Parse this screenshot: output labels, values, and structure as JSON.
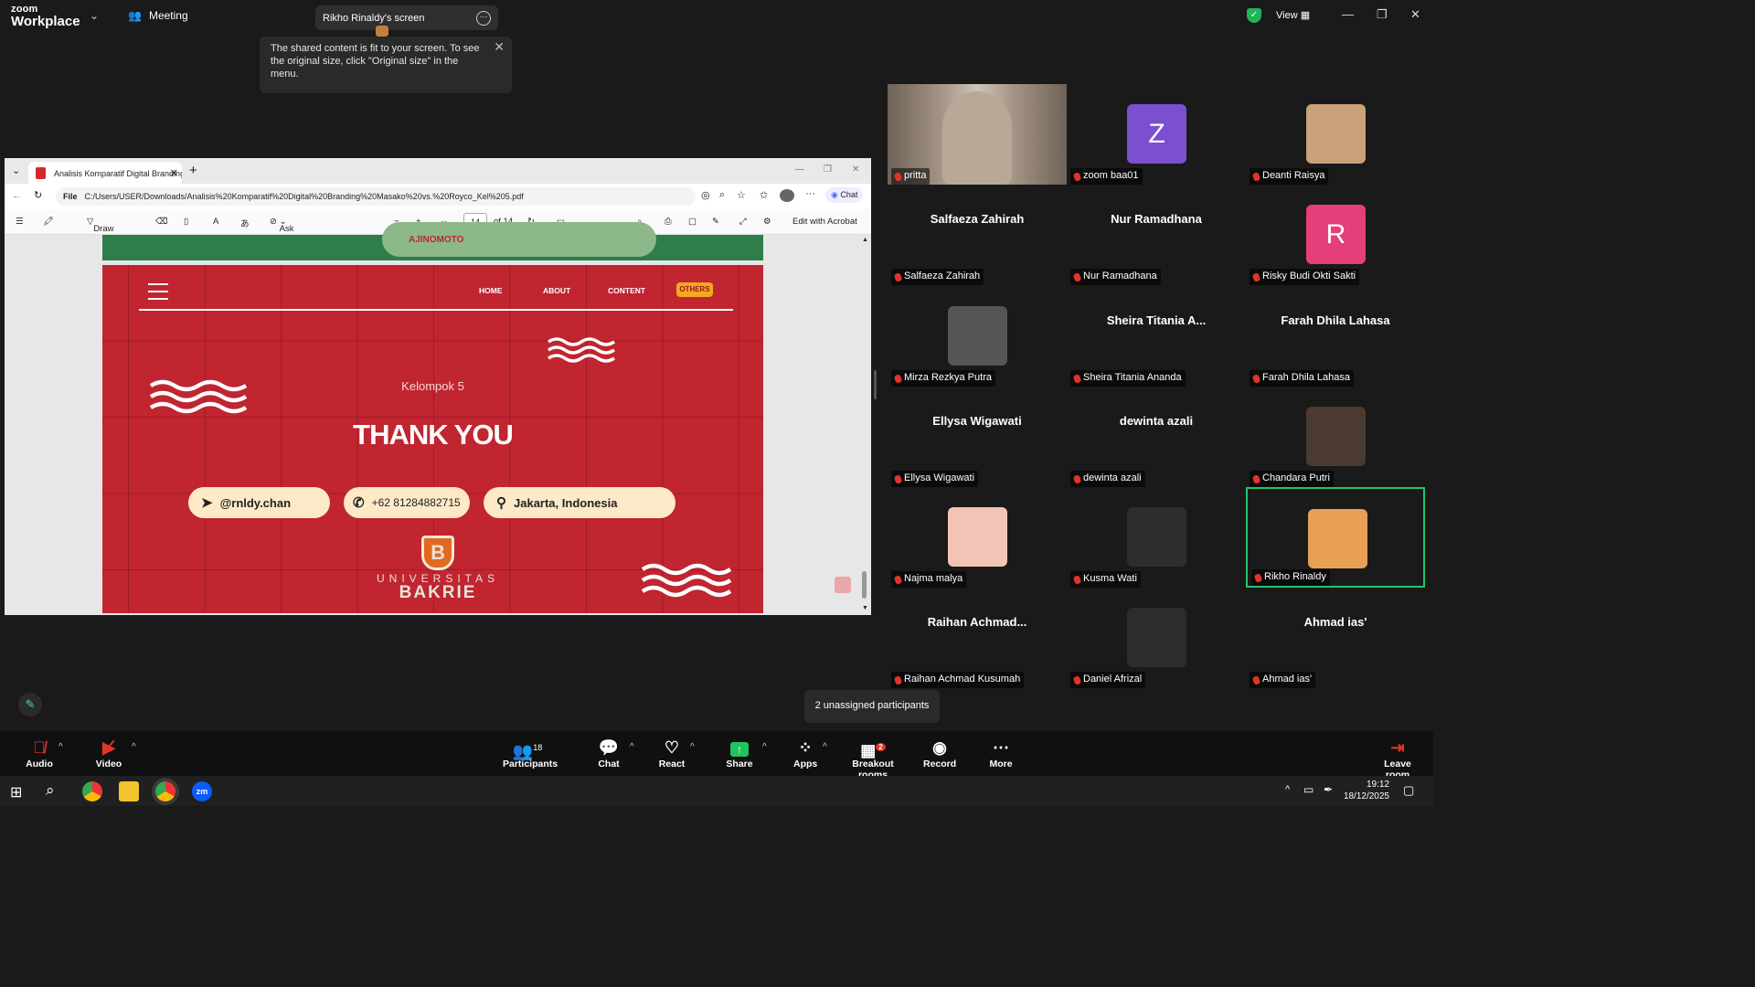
{
  "topbar": {
    "brand_small": "zoom",
    "brand": "Workplace",
    "meeting_label": "Meeting",
    "share_tab": "Rikho Rinaldy's screen",
    "view_label": "View"
  },
  "tooltip": {
    "text": "The shared content is fit to your screen. To see the original size, click \"Original size\" in the menu."
  },
  "browser": {
    "tab_title": "Analisis Komparatif Digital Branding",
    "url_prefix": "File",
    "url": "C:/Users/USER/Downloads/Analisis%20Komparatif%20Digital%20Branding%20Masako%20vs.%20Royco_Kel%205.pdf",
    "chat_label": "Chat",
    "toolbar": {
      "draw": "Draw",
      "ask_copilot": "Ask Copilot",
      "page": "14",
      "of_pages": "of 14",
      "edit_acrobat": "Edit with Acrobat"
    }
  },
  "slide": {
    "top_brand": "AJINOMOTO",
    "nav": [
      "HOME",
      "ABOUT",
      "CONTENT",
      "OTHERS"
    ],
    "group": "Kelompok 5",
    "thanks": "THANK YOU",
    "handle": "@rnldy.chan",
    "phone": "+62 81284882715",
    "location": "Jakarta, Indonesia",
    "univ_line": "UNIVERSITAS",
    "univ_name": "BAKRIE",
    "univ_letter": "B"
  },
  "participants": [
    {
      "name": "pritta",
      "display": "",
      "avatar": "photo"
    },
    {
      "name": "zoom baa01",
      "display": "",
      "avatar": "Z",
      "color": "#7b4fd0"
    },
    {
      "name": "Deanti Raisya",
      "display": "",
      "avatar": "photo"
    },
    {
      "name": "Salfaeza Zahirah",
      "display": "Salfaeza Zahirah"
    },
    {
      "name": "Nur Ramadhana",
      "display": "Nur Ramadhana"
    },
    {
      "name": "Risky Budi Okti Sakti",
      "display": "",
      "avatar": "R",
      "color": "#e63e7a"
    },
    {
      "name": "Mirza Rezkya Putra",
      "display": "",
      "avatar": "photo"
    },
    {
      "name": "Sheira Titania Ananda",
      "display": "Sheira Titania A..."
    },
    {
      "name": "Farah Dhila Lahasa",
      "display": "Farah Dhila Lahasa"
    },
    {
      "name": "Ellysa Wigawati",
      "display": "Ellysa Wigawati"
    },
    {
      "name": "dewinta azali",
      "display": "dewinta azali"
    },
    {
      "name": "Chandara Putri",
      "display": "",
      "avatar": "photo"
    },
    {
      "name": "Najma malya",
      "display": "",
      "avatar": "photo"
    },
    {
      "name": "Kusma Wati",
      "display": "",
      "avatar": "photo"
    },
    {
      "name": "Rikho Rinaldy",
      "display": "",
      "avatar": "photo"
    },
    {
      "name": "Raihan Achmad Kusumah",
      "display": "Raihan  Achmad..."
    },
    {
      "name": "Daniel Afrizal",
      "display": "",
      "avatar": "photo"
    },
    {
      "name": "Ahmad ias'",
      "display": "Ahmad ias'"
    }
  ],
  "unassigned": "2 unassigned participants",
  "controls": {
    "audio": "Audio",
    "video": "Video",
    "participants": "Participants",
    "participants_count": "18",
    "chat": "Chat",
    "react": "React",
    "share": "Share",
    "apps": "Apps",
    "breakout": "Breakout rooms",
    "breakout_badge": "2",
    "record": "Record",
    "more": "More",
    "leave": "Leave room"
  },
  "taskbar": {
    "time": "19:12",
    "date": "18/12/2025"
  },
  "colors": {
    "accent": "#22c56c",
    "slide_red": "#c02530",
    "zoom_blue": "#0b5cff"
  }
}
